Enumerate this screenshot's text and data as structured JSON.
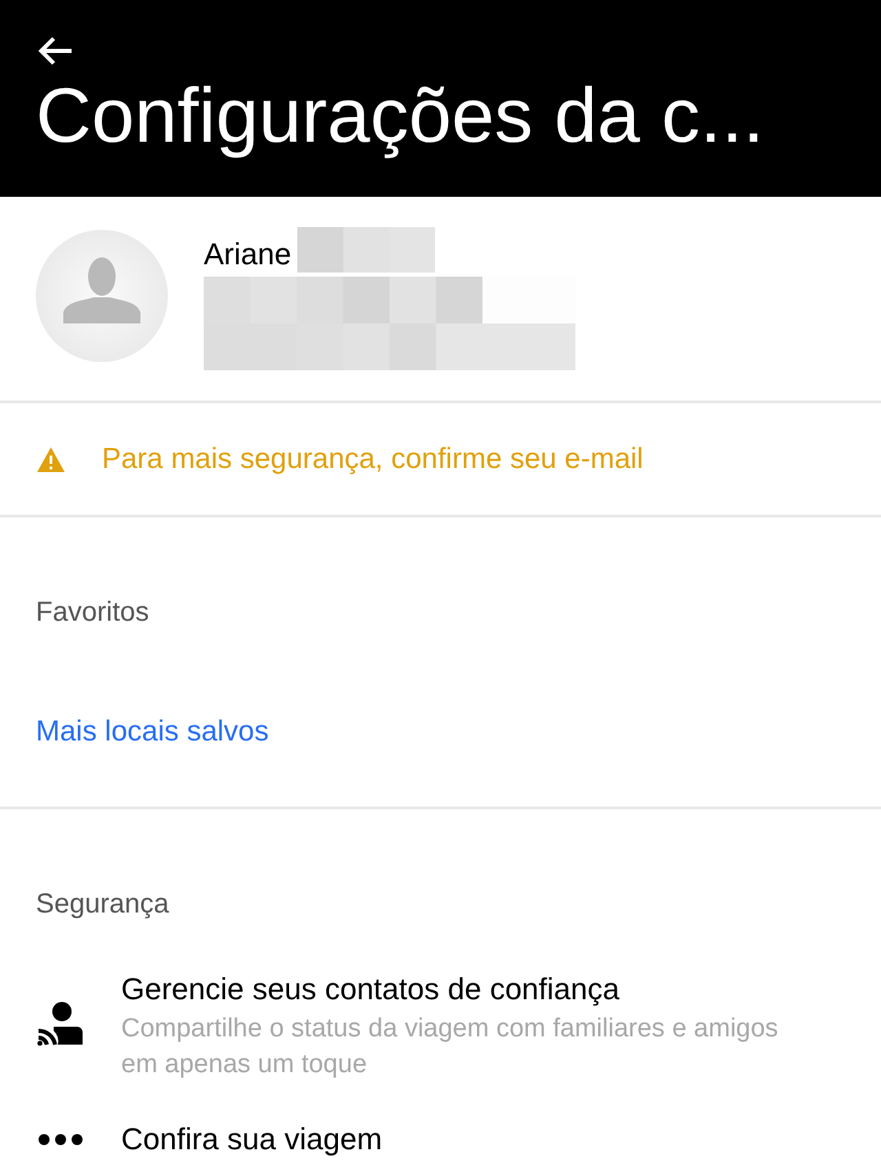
{
  "header": {
    "title": "Configurações da c..."
  },
  "profile": {
    "name": "Ariane"
  },
  "warning": {
    "text": "Para mais segurança, confirme seu e-mail"
  },
  "favorites": {
    "heading": "Favoritos",
    "link": "Mais locais salvos"
  },
  "security": {
    "heading": "Segurança",
    "items": [
      {
        "kind": "contacts",
        "title": "Gerencie seus contatos de confiança",
        "subtitle": "Compartilhe o status da viagem com familiares e amigos em apenas um toque"
      },
      {
        "kind": "verify",
        "title": "Confira sua viagem"
      }
    ]
  }
}
